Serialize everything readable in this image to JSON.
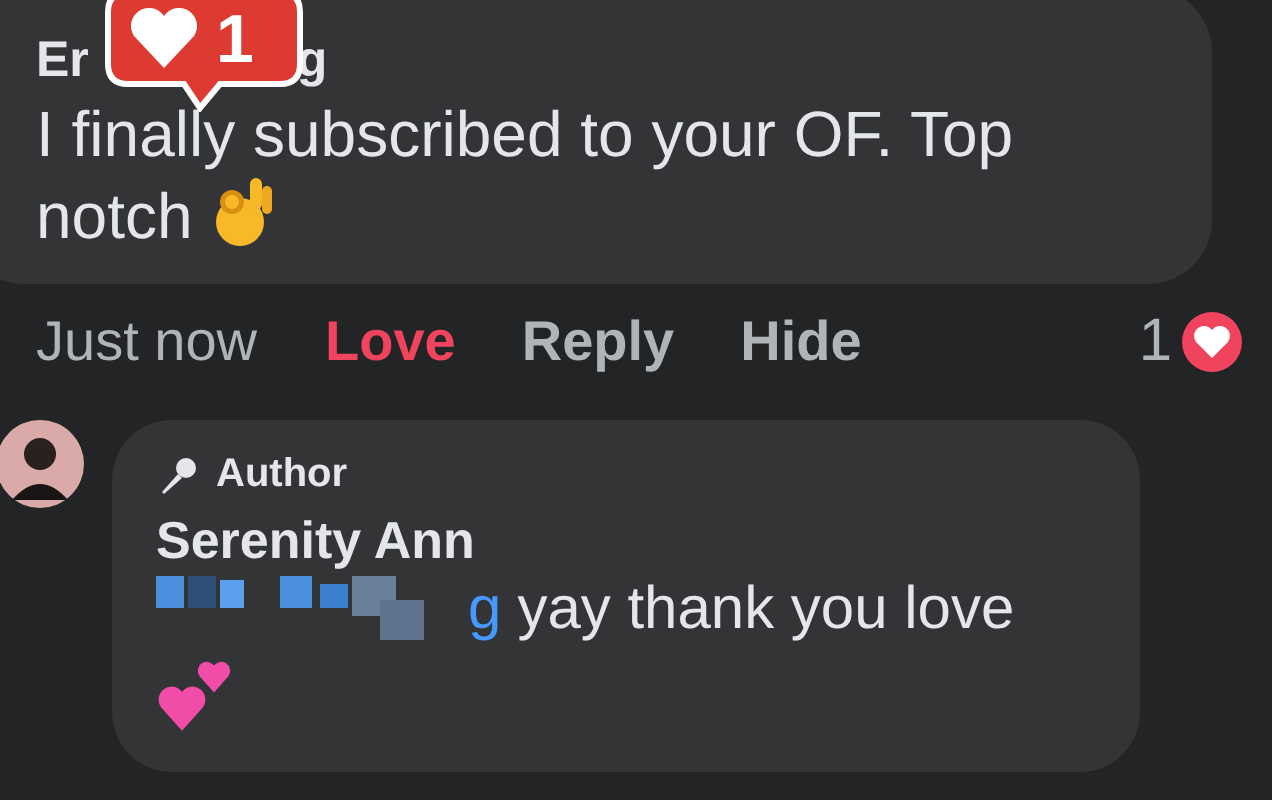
{
  "notification_badge": {
    "count": "1"
  },
  "comment": {
    "author_fragments": [
      "Er",
      "g"
    ],
    "text": "I finally subscribed to your OF. Top notch"
  },
  "actions": {
    "time": "Just now",
    "buttons": [
      {
        "label": "Love",
        "selected": true
      },
      {
        "label": "Reply",
        "selected": false
      },
      {
        "label": "Hide",
        "selected": false
      }
    ],
    "reaction_count": "1"
  },
  "reply": {
    "badge": "Author",
    "author": "Serenity Ann",
    "mention_visible": "g",
    "text": "yay thank you love"
  }
}
